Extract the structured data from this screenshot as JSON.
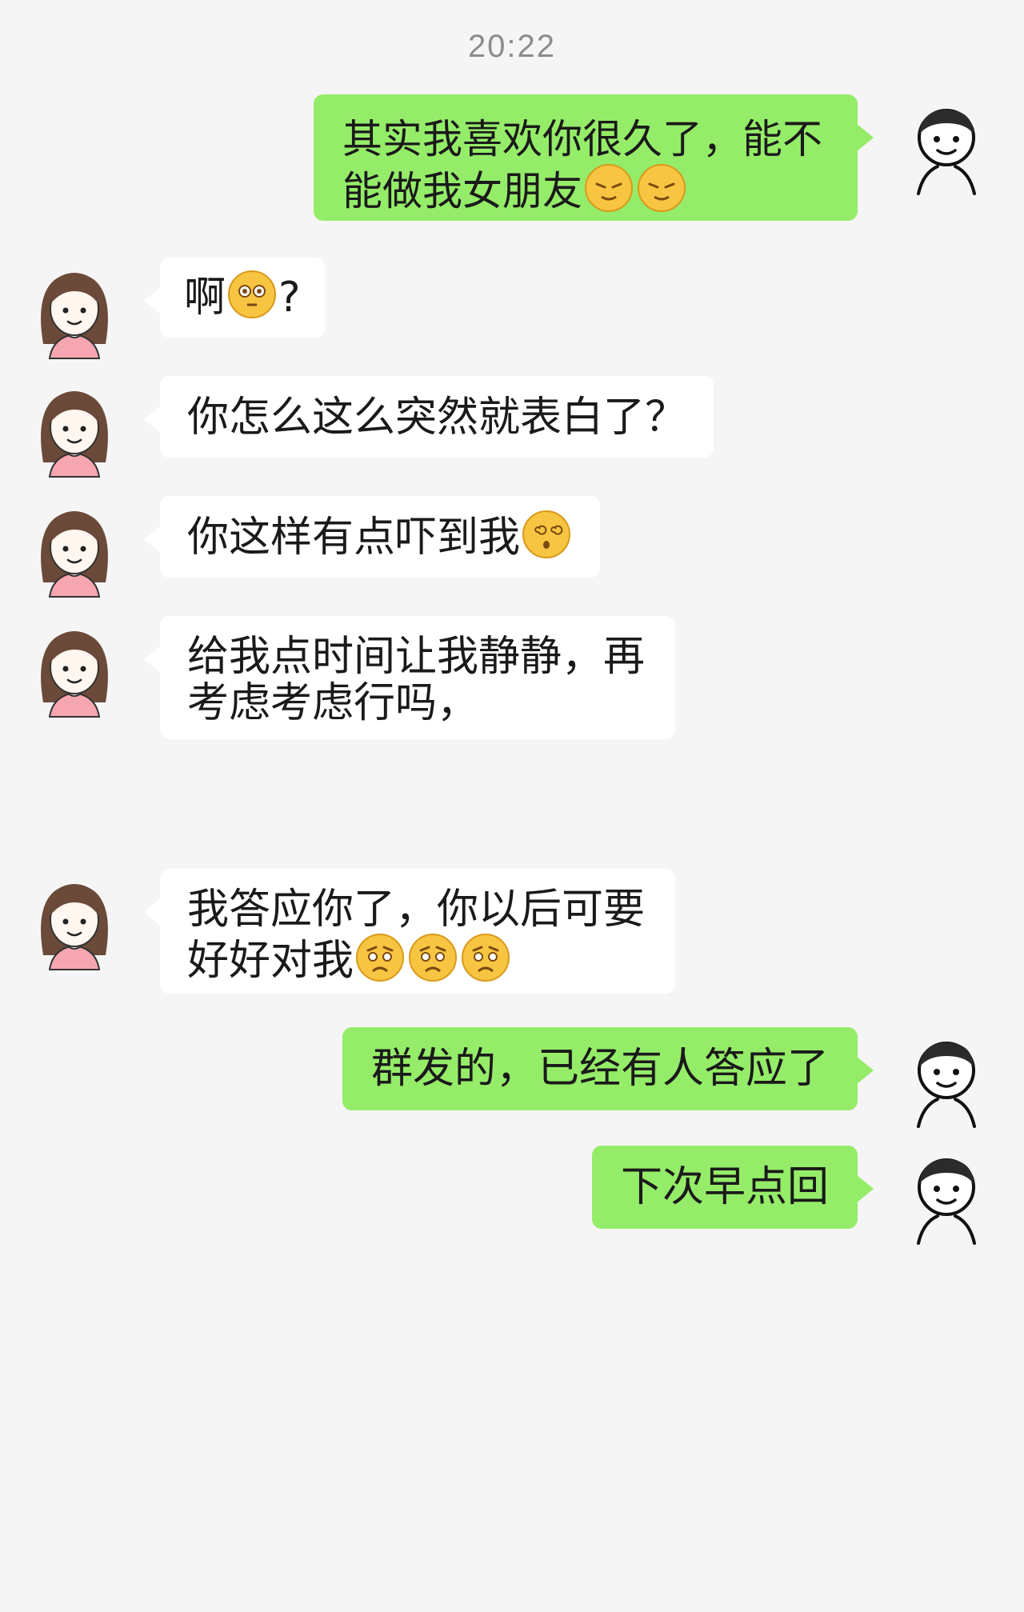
{
  "chat": {
    "timestamp": "20:22",
    "messages": [
      {
        "sender": "me",
        "text": "其实我喜欢你很久了，能不能做我女朋友",
        "emojis": [
          "smug-face-emoji",
          "smug-face-emoji"
        ]
      },
      {
        "sender": "her",
        "text": "啊",
        "emojis": [
          "flushed-face-emoji"
        ],
        "suffix": "?"
      },
      {
        "sender": "her",
        "text": "你怎么这么突然就表白了？"
      },
      {
        "sender": "her",
        "text": "你这样有点吓到我",
        "emojis": [
          "dizzy-face-emoji"
        ]
      },
      {
        "sender": "her",
        "text": "给我点时间让我静静，再考虑考虑行吗，"
      },
      {
        "sender": "her",
        "text": "我答应你了，你以后可要好好对我",
        "emojis": [
          "worried-face-emoji",
          "worried-face-emoji",
          "worried-face-emoji"
        ]
      },
      {
        "sender": "me",
        "text": "群发的，已经有人答应了"
      },
      {
        "sender": "me",
        "text": "下次早点回"
      }
    ]
  },
  "colors": {
    "background": "#f5f5f5",
    "outgoing_bubble": "#95ec69",
    "incoming_bubble": "#ffffff",
    "timestamp": "#8c8c8c"
  },
  "avatars": {
    "me": "boy-avatar-icon",
    "her": "girl-avatar-icon"
  }
}
